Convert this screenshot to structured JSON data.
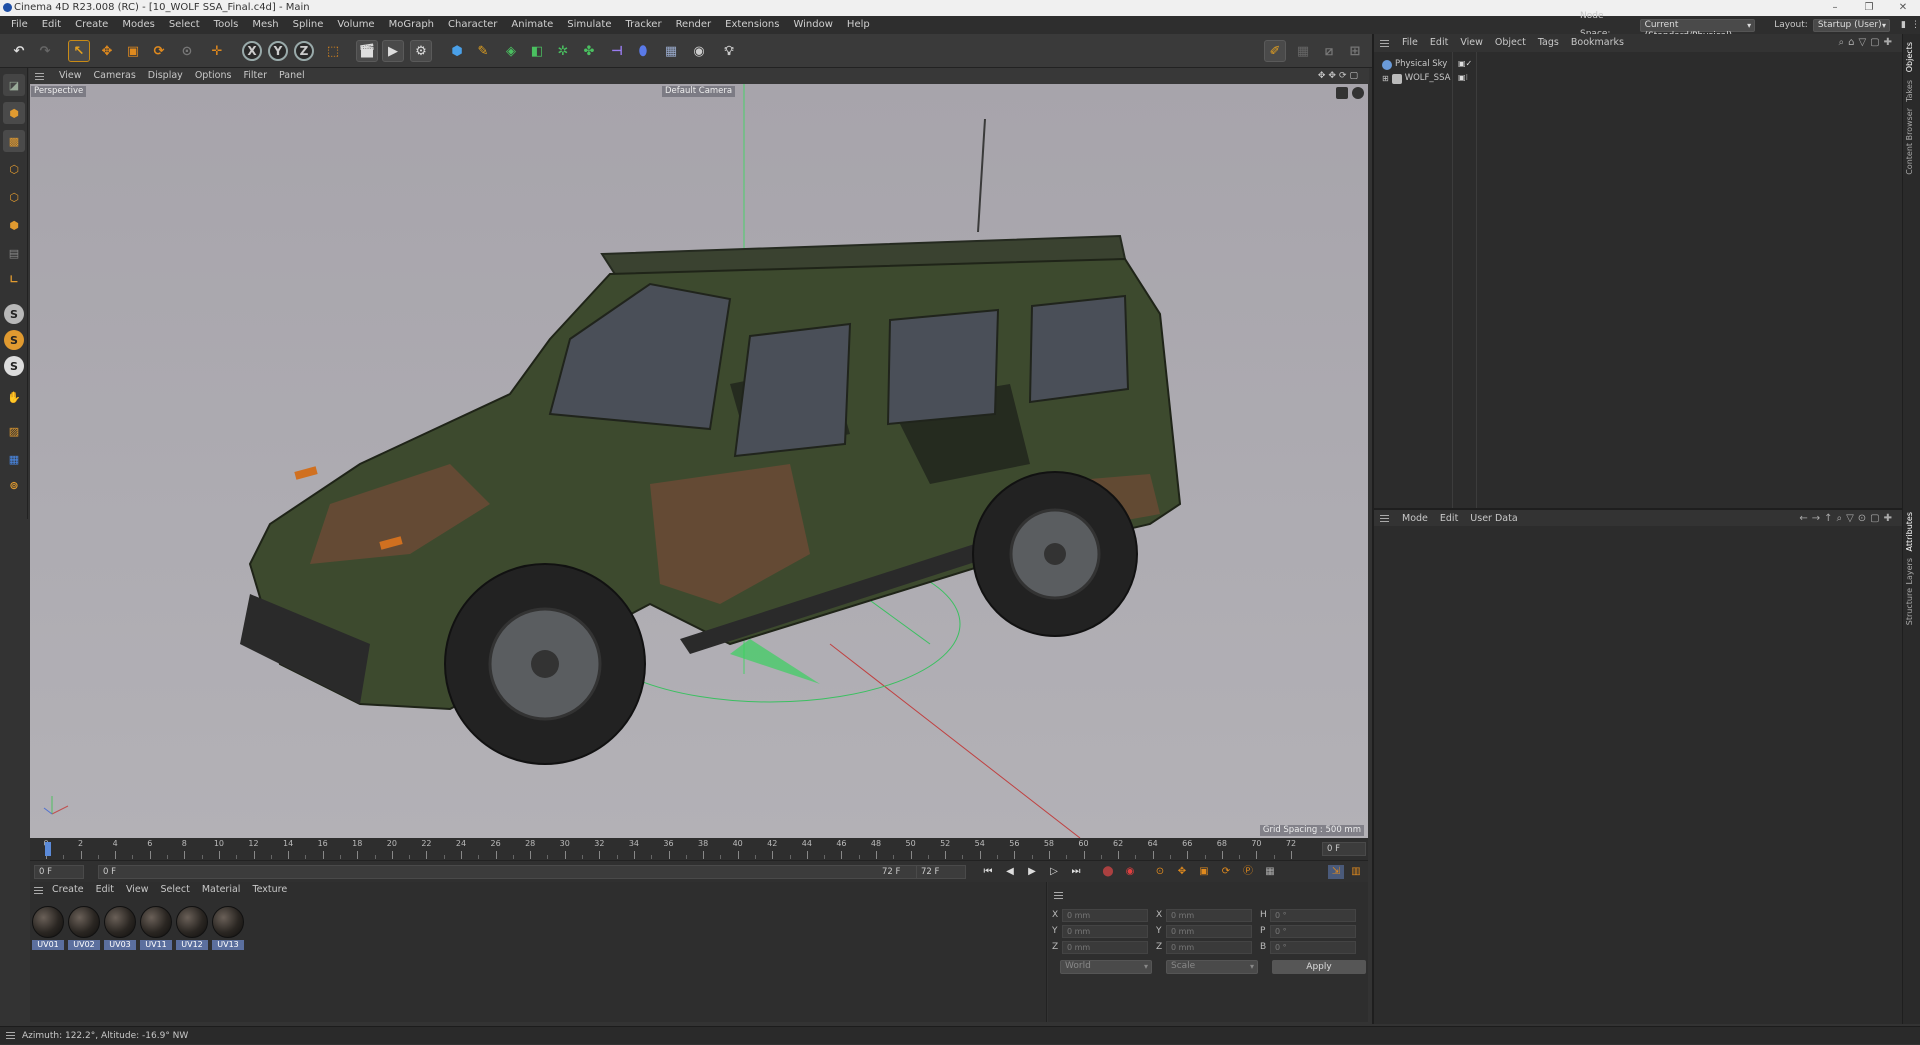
{
  "window": {
    "title": "Cinema 4D R23.008 (RC) - [10_WOLF SSA_Final.c4d] - Main",
    "controls": [
      "–",
      "❐",
      "✕"
    ]
  },
  "menubar": {
    "items": [
      "File",
      "Edit",
      "Create",
      "Modes",
      "Select",
      "Tools",
      "Mesh",
      "Spline",
      "Volume",
      "MoGraph",
      "Character",
      "Animate",
      "Simulate",
      "Tracker",
      "Render",
      "Extensions",
      "Window",
      "Help"
    ],
    "node_space_label": "Node Space:",
    "node_space_value": "Current (Standard/Physical)",
    "layout_label": "Layout:",
    "layout_value": "Startup (User)"
  },
  "viewport": {
    "menu": [
      "View",
      "Cameras",
      "Display",
      "Options",
      "Filter",
      "Panel"
    ],
    "projection": "Perspective",
    "camera": "Default Camera",
    "grid_spacing": "Grid Spacing : 500 mm"
  },
  "timeline": {
    "ticks": [
      "0",
      "2",
      "4",
      "6",
      "8",
      "10",
      "12",
      "14",
      "16",
      "18",
      "20",
      "22",
      "24",
      "26",
      "28",
      "30",
      "32",
      "34",
      "36",
      "38",
      "40",
      "42",
      "44",
      "46",
      "48",
      "50",
      "52",
      "54",
      "56",
      "58",
      "60",
      "62",
      "64",
      "66",
      "68",
      "70",
      "72"
    ],
    "current_frame": "0 F",
    "start_frame": "0 F",
    "preview_start": "0 F",
    "preview_end": "72 F",
    "end_frame": "72 F"
  },
  "materials": {
    "menu": [
      "Create",
      "Edit",
      "View",
      "Select",
      "Material",
      "Texture"
    ],
    "items": [
      "UV01",
      "UV02",
      "UV03",
      "UV11",
      "UV12",
      "UV13"
    ]
  },
  "coordinates": {
    "rows": [
      {
        "a": "X",
        "av": "0 mm",
        "b": "X",
        "bv": "0 mm",
        "c": "H",
        "cv": "0 °"
      },
      {
        "a": "Y",
        "av": "0 mm",
        "b": "Y",
        "bv": "0 mm",
        "c": "P",
        "cv": "0 °"
      },
      {
        "a": "Z",
        "av": "0 mm",
        "b": "Z",
        "bv": "0 mm",
        "c": "B",
        "cv": "0 °"
      }
    ],
    "mode": "World",
    "type": "Scale",
    "apply": "Apply"
  },
  "objects": {
    "menu": [
      "File",
      "Edit",
      "View",
      "Object",
      "Tags",
      "Bookmarks"
    ],
    "items": [
      "Physical Sky",
      "WOLF_SSA"
    ]
  },
  "attributes": {
    "menu": [
      "Mode",
      "Edit",
      "User Data"
    ]
  },
  "side_tabs": {
    "top": [
      "Objects",
      "Takes",
      "Content Browser"
    ],
    "bottom": [
      "Attributes",
      "Layers",
      "Structure"
    ]
  },
  "status": "Azimuth: 122.2°, Altitude: -16.9°  NW",
  "colors": {
    "accent": "#5b6f9e",
    "bg": "#333333",
    "orange": "#e08a1e",
    "viewport": "#aaa8ae"
  }
}
